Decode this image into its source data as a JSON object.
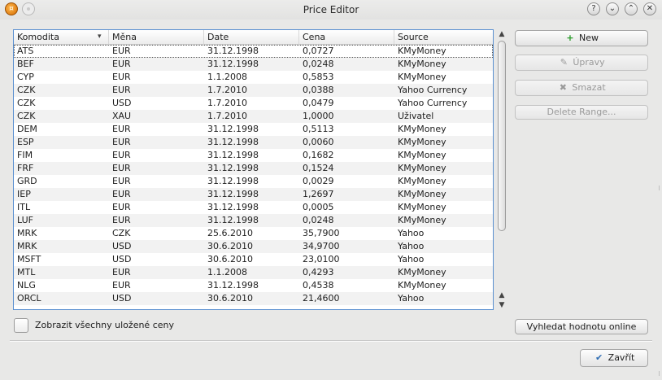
{
  "window": {
    "title": "Price Editor",
    "controls": [
      "?",
      "⌄",
      "⌃",
      "✕"
    ]
  },
  "table": {
    "columns": [
      "Komodita",
      "Měna",
      "Date",
      "Cena",
      "Source"
    ],
    "rows": [
      [
        "ATS",
        "EUR",
        "31.12.1998",
        "0,0727",
        "KMyMoney"
      ],
      [
        "BEF",
        "EUR",
        "31.12.1998",
        "0,0248",
        "KMyMoney"
      ],
      [
        "CYP",
        "EUR",
        "1.1.2008",
        "0,5853",
        "KMyMoney"
      ],
      [
        "CZK",
        "EUR",
        "1.7.2010",
        "0,0388",
        "Yahoo Currency"
      ],
      [
        "CZK",
        "USD",
        "1.7.2010",
        "0,0479",
        "Yahoo Currency"
      ],
      [
        "CZK",
        "XAU",
        "1.7.2010",
        "1,0000",
        "Uživatel"
      ],
      [
        "DEM",
        "EUR",
        "31.12.1998",
        "0,5113",
        "KMyMoney"
      ],
      [
        "ESP",
        "EUR",
        "31.12.1998",
        "0,0060",
        "KMyMoney"
      ],
      [
        "FIM",
        "EUR",
        "31.12.1998",
        "0,1682",
        "KMyMoney"
      ],
      [
        "FRF",
        "EUR",
        "31.12.1998",
        "0,1524",
        "KMyMoney"
      ],
      [
        "GRD",
        "EUR",
        "31.12.1998",
        "0,0029",
        "KMyMoney"
      ],
      [
        "IEP",
        "EUR",
        "31.12.1998",
        "1,2697",
        "KMyMoney"
      ],
      [
        "ITL",
        "EUR",
        "31.12.1998",
        "0,0005",
        "KMyMoney"
      ],
      [
        "LUF",
        "EUR",
        "31.12.1998",
        "0,0248",
        "KMyMoney"
      ],
      [
        "MRK",
        "CZK",
        "25.6.2010",
        "35,7900",
        "Yahoo"
      ],
      [
        "MRK",
        "USD",
        "30.6.2010",
        "34,9700",
        "Yahoo"
      ],
      [
        "MSFT",
        "USD",
        "30.6.2010",
        "23,0100",
        "Yahoo"
      ],
      [
        "MTL",
        "EUR",
        "1.1.2008",
        "0,4293",
        "KMyMoney"
      ],
      [
        "NLG",
        "EUR",
        "31.12.1998",
        "0,4538",
        "KMyMoney"
      ],
      [
        "ORCL",
        "USD",
        "30.6.2010",
        "21,4600",
        "Yahoo"
      ]
    ]
  },
  "buttons": {
    "new": "New",
    "edit": "Úpravy",
    "delete": "Smazat",
    "delete_range": "Delete Range...",
    "online": "Vyhledat hodnotu online",
    "close": "Zavřít"
  },
  "checkbox": {
    "label": "Zobrazit všechny uložené ceny",
    "checked": false
  }
}
